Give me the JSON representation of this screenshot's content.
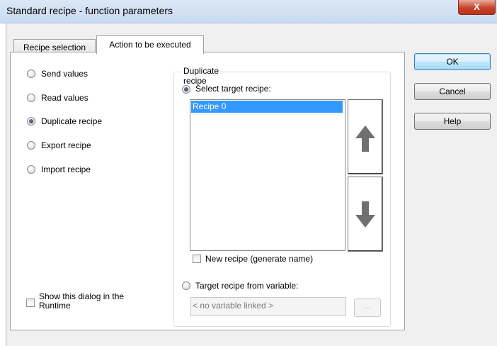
{
  "window": {
    "title": "Standard recipe - function parameters",
    "close_label": "X"
  },
  "tabs": [
    {
      "label": "Recipe selection",
      "active": false
    },
    {
      "label": "Action to be executed",
      "active": true
    }
  ],
  "actions": [
    {
      "label": "Send values",
      "checked": false
    },
    {
      "label": "Read values",
      "checked": false
    },
    {
      "label": "Duplicate recipe",
      "checked": true
    },
    {
      "label": "Export recipe",
      "checked": false
    },
    {
      "label": "Import recipe",
      "checked": false
    }
  ],
  "show_dialog": {
    "label_line1": "Show this dialog in the",
    "label_line2": "Runtime",
    "checked": false
  },
  "duplicate_group": {
    "title": "Duplicate recipe",
    "select_target_label": "Select target recipe:",
    "select_target_checked": true,
    "recipes": [
      "Recipe 0"
    ],
    "selected_recipe": "Recipe 0",
    "new_recipe_label": "New recipe (generate name)",
    "new_recipe_checked": false,
    "target_variable_label": "Target recipe from variable:",
    "target_variable_checked": false,
    "variable_value": "< no variable linked >",
    "ellipsis_label": "..."
  },
  "buttons": {
    "ok": "OK",
    "cancel": "Cancel",
    "help": "Help"
  },
  "icons": {
    "move_up": "up-arrow-icon",
    "move_down": "down-arrow-icon"
  },
  "colors": {
    "selection": "#3399ff",
    "arrow": "#707070"
  }
}
